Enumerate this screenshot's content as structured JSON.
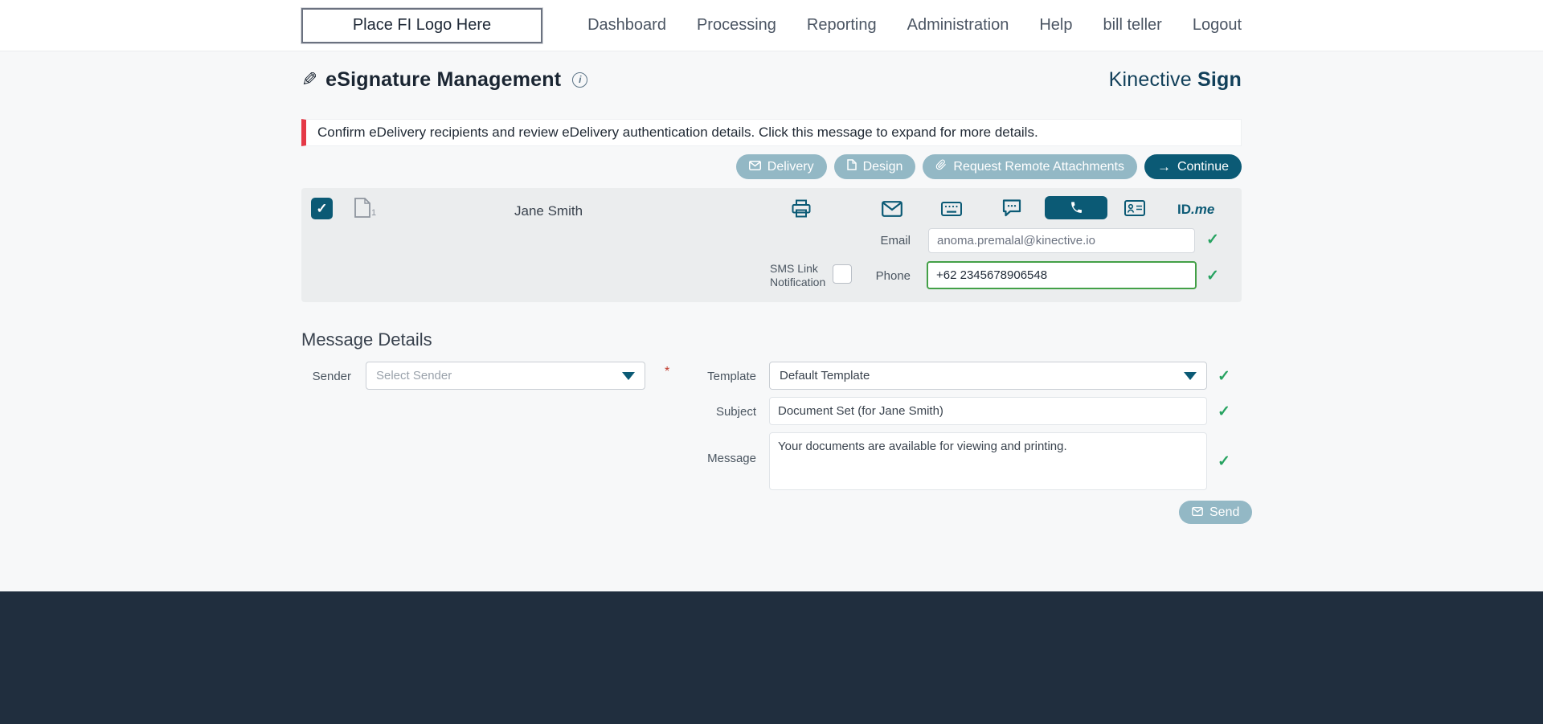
{
  "header": {
    "logo_text": "Place FI Logo Here",
    "nav": [
      {
        "label": "Dashboard"
      },
      {
        "label": "Processing"
      },
      {
        "label": "Reporting"
      },
      {
        "label": "Administration"
      },
      {
        "label": "Help"
      },
      {
        "label": "bill teller"
      },
      {
        "label": "Logout"
      }
    ]
  },
  "page": {
    "title": "eSignature Management",
    "brand": {
      "name": "Kinective",
      "product": "Sign"
    },
    "alert": "Confirm eDelivery recipients and review eDelivery authentication details. Click this message to expand for more details."
  },
  "actions": {
    "delivery": "Delivery",
    "design": "Design",
    "request_remote_attachments": "Request Remote Attachments",
    "continue": "Continue"
  },
  "recipient": {
    "name": "Jane Smith",
    "document_count": "1",
    "idme_id": "ID",
    "idme_me": ".me",
    "email": {
      "label": "Email",
      "value": "anoma.premalal@kinective.io"
    },
    "sms_link_notification_label": "SMS Link Notification",
    "phone": {
      "label": "Phone",
      "value": "+62 2345678906548"
    }
  },
  "message_details": {
    "heading": "Message Details",
    "sender": {
      "label": "Sender",
      "placeholder": "Select Sender",
      "required": "*"
    },
    "template": {
      "label": "Template",
      "value": "Default Template"
    },
    "subject": {
      "label": "Subject",
      "value": "Document Set (for Jane Smith)"
    },
    "message": {
      "label": "Message",
      "value": "Your documents are available for viewing and printing."
    },
    "send": "Send"
  },
  "icons": {
    "check": "✓",
    "arrow_right": "→",
    "pen": "✎",
    "info": "i"
  },
  "colors": {
    "accent_teal": "#0b5a75",
    "muted_button": "#93b8c5",
    "alert_red": "#e53947",
    "success_green": "#27a361",
    "footer_navy": "#202e3e"
  }
}
